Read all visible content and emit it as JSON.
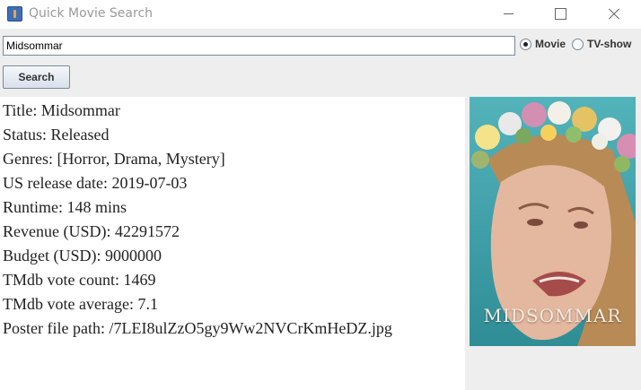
{
  "window": {
    "title": "Quick Movie Search"
  },
  "search": {
    "query": "Midsommar",
    "button_label": "Search"
  },
  "media_type": {
    "movie_label": "Movie",
    "tv_label": "TV-show",
    "selected": "Movie"
  },
  "details": {
    "title": "Title: Midsommar",
    "status": "Status: Released",
    "genres": "Genres: [Horror, Drama, Mystery]",
    "release_date": "US release date: 2019-07-03",
    "runtime": "Runtime: 148 mins",
    "revenue": "Revenue (USD): 42291572",
    "budget": "Budget (USD): 9000000",
    "vote_count": "TMdb vote count: 1469",
    "vote_average": "TMdb vote average: 7.1",
    "poster_path": "Poster file path: /7LEI8ulZzO5gy9Ww2NVCrKmHeDZ.jpg"
  },
  "poster": {
    "text": "MIDSOMMAR"
  },
  "colors": {
    "accent": "#3d6fb8",
    "poster_bg": "#3f9fa8"
  },
  "icons": [
    "app-icon",
    "minimize-icon",
    "maximize-icon",
    "close-icon"
  ]
}
